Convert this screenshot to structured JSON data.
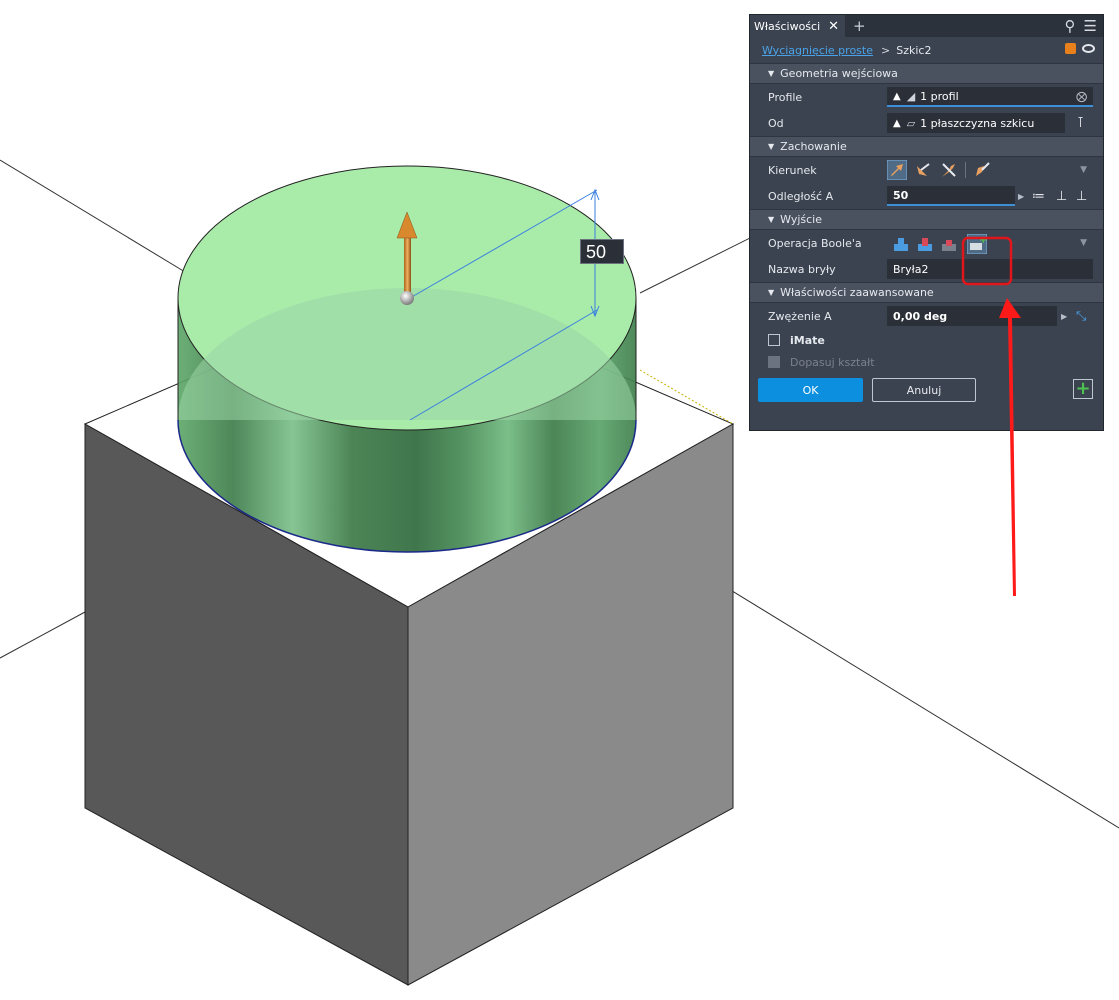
{
  "viewport": {
    "dimension_value": "50"
  },
  "panel": {
    "tab_label": "Właściwości",
    "tab_close": "✕",
    "tab_add": "+",
    "breadcrumb_link": "Wyciągnięcie proste",
    "breadcrumb_sep": ">",
    "breadcrumb_current": "Szkic2",
    "sections": {
      "input_geometry": "Geometria wejściowa",
      "behavior": "Zachowanie",
      "output": "Wyjście",
      "advanced": "Właściwości zaawansowane"
    },
    "profiles_label": "Profile",
    "profiles_value": "1 profil",
    "from_label": "Od",
    "from_value": "1 płaszczyzna szkicu",
    "direction_label": "Kierunek",
    "distance_label": "Odległość A",
    "distance_value": "50",
    "boolean_label": "Operacja Boole'a",
    "body_name_label": "Nazwa bryły",
    "body_name_value": "Bryła2",
    "taper_label": "Zwężenie A",
    "taper_value": "0,00 deg",
    "imate_label": "iMate",
    "match_shape_label": "Dopasuj kształt",
    "ok_label": "OK",
    "cancel_label": "Anuluj",
    "icons": [
      "search-icon",
      "menu-icon",
      "cube-icon",
      "eye-icon",
      "pointer-icon",
      "profile-icon",
      "plane-icon",
      "clear-icon",
      "flip-icon",
      "join-icon",
      "cut-icon",
      "intersect-icon",
      "new-solid-icon",
      "plus-icon"
    ]
  },
  "colors": {
    "panel_bg": "#3b4350",
    "accent": "#0d8fe0",
    "cylinder": "#6cc86c",
    "arrow": "#ff1a1a"
  }
}
